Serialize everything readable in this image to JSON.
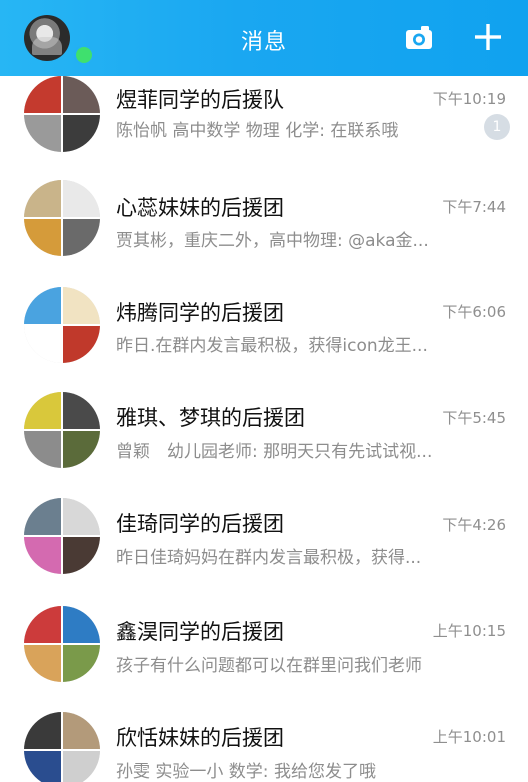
{
  "header": {
    "title": "消息",
    "accent": "#1aa7f1"
  },
  "conversations": [
    {
      "name": "煜菲同学的后援队",
      "time": "下午10:19",
      "preview": "陈怡帆 高中数学 物理 化学: 在联系哦",
      "unread": "1",
      "avatar_colors": [
        "#c43a2e",
        "#6b5b58",
        "#9a9a9a",
        "#3c3c3c"
      ]
    },
    {
      "name": "心蕊妹妹的后援团",
      "time": "下午7:44",
      "preview": "贾其彬，重庆二外，高中物理: @aka金...",
      "avatar_colors": [
        "#c9b48a",
        "#e9e9e9",
        "#d59b3a",
        "#6a6a6a"
      ]
    },
    {
      "name": "炜腾同学的后援团",
      "time": "下午6:06",
      "preview": "昨日.在群内发言最积极，获得icon龙王...",
      "avatar_colors": [
        "#4aa3e0",
        "#f1e3c2",
        "#ffffff",
        "#c0392b"
      ]
    },
    {
      "name": "雅琪、梦琪的后援团",
      "time": "下午5:45",
      "preview": "曾颖　幼儿园老师: 那明天只有先试试视...",
      "avatar_colors": [
        "#d9c83b",
        "#4a4a4a",
        "#8c8c8c",
        "#5b6b3a"
      ]
    },
    {
      "name": "佳琦同学的后援团",
      "time": "下午4:26",
      "preview": "昨日佳琦妈妈在群内发言最积极，获得...",
      "avatar_colors": [
        "#6b7f8f",
        "#d8d8d8",
        "#d46ab0",
        "#4a3a34"
      ]
    },
    {
      "name": "鑫淏同学的后援团",
      "time": "上午10:15",
      "preview": "孩子有什么问题都可以在群里问我们老师",
      "avatar_colors": [
        "#cc3b3b",
        "#2e7cc4",
        "#d9a35a",
        "#7a9a4a"
      ]
    },
    {
      "name": "欣恬妹妹的后援团",
      "time": "上午10:01",
      "preview": "孙雯 实验一小 数学: 我给您发了哦",
      "avatar_colors": [
        "#3a3a3a",
        "#b39a7a",
        "#2a4d8f",
        "#cfcfcf"
      ]
    }
  ]
}
